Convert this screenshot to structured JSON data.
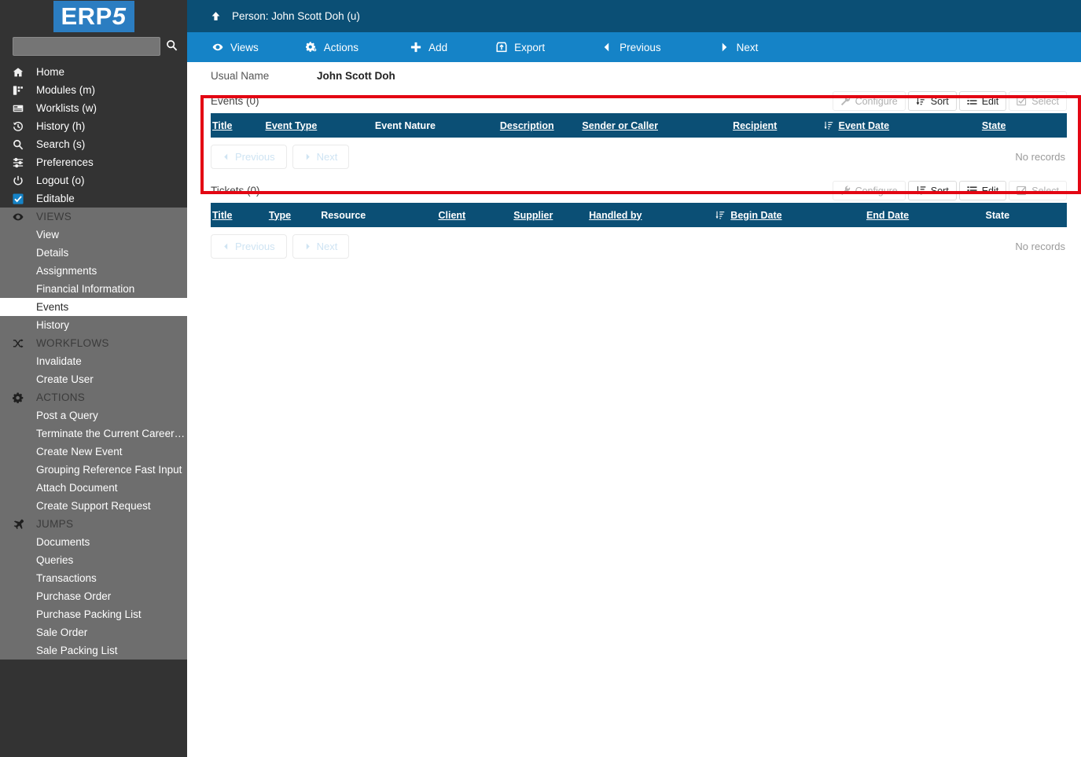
{
  "brand": {
    "logo_text_erp": "ERP",
    "logo_text_5": "5",
    "logo_bg": "#2b7dc1"
  },
  "sidebar": {
    "search": {
      "value": "",
      "placeholder": "",
      "icon": "search-icon"
    },
    "top_items": [
      {
        "label": "Home",
        "icon": "home-icon"
      },
      {
        "label": "Modules (m)",
        "icon": "modules-icon"
      },
      {
        "label": "Worklists (w)",
        "icon": "worklists-icon"
      },
      {
        "label": "History (h)",
        "icon": "history-icon"
      },
      {
        "label": "Search (s)",
        "icon": "search-icon"
      },
      {
        "label": "Preferences",
        "icon": "sliders-icon"
      },
      {
        "label": "Logout (o)",
        "icon": "power-icon"
      },
      {
        "label": "Editable",
        "icon": "checkbox-checked-icon"
      }
    ],
    "groups": [
      {
        "label": "VIEWS",
        "icon": "eye-icon",
        "items": [
          {
            "label": "View",
            "selected": false
          },
          {
            "label": "Details",
            "selected": false
          },
          {
            "label": "Assignments",
            "selected": false
          },
          {
            "label": "Financial Information",
            "selected": false
          },
          {
            "label": "Events",
            "selected": true
          },
          {
            "label": "History",
            "selected": false
          }
        ]
      },
      {
        "label": "WORKFLOWS",
        "icon": "workflow-icon",
        "items": [
          {
            "label": "Invalidate",
            "selected": false
          },
          {
            "label": "Create User",
            "selected": false
          }
        ]
      },
      {
        "label": "ACTIONS",
        "icon": "gear-icon",
        "items": [
          {
            "label": "Post a Query",
            "selected": false
          },
          {
            "label": "Terminate the Current Career…",
            "selected": false
          },
          {
            "label": "Create New Event",
            "selected": false
          },
          {
            "label": "Grouping Reference Fast Input",
            "selected": false
          },
          {
            "label": "Attach Document",
            "selected": false
          },
          {
            "label": "Create Support Request",
            "selected": false
          }
        ]
      },
      {
        "label": "JUMPS",
        "icon": "jumps-icon",
        "items": [
          {
            "label": "Documents",
            "selected": false
          },
          {
            "label": "Queries",
            "selected": false
          },
          {
            "label": "Transactions",
            "selected": false
          },
          {
            "label": "Purchase Order",
            "selected": false
          },
          {
            "label": "Purchase Packing List",
            "selected": false
          },
          {
            "label": "Sale Order",
            "selected": false
          },
          {
            "label": "Sale Packing List",
            "selected": false
          }
        ]
      }
    ]
  },
  "header": {
    "title": "Person: John Scott Doh (u)",
    "up_icon": "arrow-up-icon",
    "bg": "#0b4f75"
  },
  "toolbar": {
    "bg": "#1583c7",
    "views_label": "Views",
    "actions_label": "Actions",
    "add_label": "Add",
    "export_label": "Export",
    "previous_label": "Previous",
    "next_label": "Next"
  },
  "field": {
    "usual_name_label": "Usual Name",
    "usual_name_value": "John Scott Doh"
  },
  "listbox_buttons": {
    "configure": "Configure",
    "sort": "Sort",
    "edit": "Edit",
    "select": "Select"
  },
  "pagination": {
    "previous": "Previous",
    "next": "Next"
  },
  "events": {
    "title": "Events (0)",
    "columns": [
      {
        "label": "Title",
        "sortable": true,
        "sorted": false
      },
      {
        "label": "Event Type",
        "sortable": true,
        "sorted": false
      },
      {
        "label": "Event Nature",
        "sortable": false,
        "sorted": false
      },
      {
        "label": "Description",
        "sortable": true,
        "sorted": false
      },
      {
        "label": "Sender or Caller",
        "sortable": true,
        "sorted": false
      },
      {
        "label": "Recipient",
        "sortable": true,
        "sorted": false
      },
      {
        "label": "Event Date",
        "sortable": true,
        "sorted": true
      },
      {
        "label": "State",
        "sortable": true,
        "sorted": false
      }
    ],
    "rows": [],
    "empty_text": "No records"
  },
  "tickets": {
    "title": "Tickets (0)",
    "columns": [
      {
        "label": "Title",
        "sortable": true,
        "sorted": false
      },
      {
        "label": "Type",
        "sortable": true,
        "sorted": false
      },
      {
        "label": "Resource",
        "sortable": false,
        "sorted": false
      },
      {
        "label": "Client",
        "sortable": true,
        "sorted": false
      },
      {
        "label": "Supplier",
        "sortable": true,
        "sorted": false
      },
      {
        "label": "Handled by",
        "sortable": true,
        "sorted": false
      },
      {
        "label": "Begin Date",
        "sortable": true,
        "sorted": true
      },
      {
        "label": "End Date",
        "sortable": true,
        "sorted": false
      },
      {
        "label": "State",
        "sortable": false,
        "sorted": false
      }
    ],
    "rows": [],
    "empty_text": "No records"
  },
  "annotation": {
    "highlight_color": "#e30613",
    "target": "events-listbox"
  },
  "colors": {
    "sidebar_dark": "#333333",
    "sidebar_gray": "#6e6e6e",
    "title_blue": "#0b4f75",
    "toolbar_blue": "#1583c7"
  }
}
